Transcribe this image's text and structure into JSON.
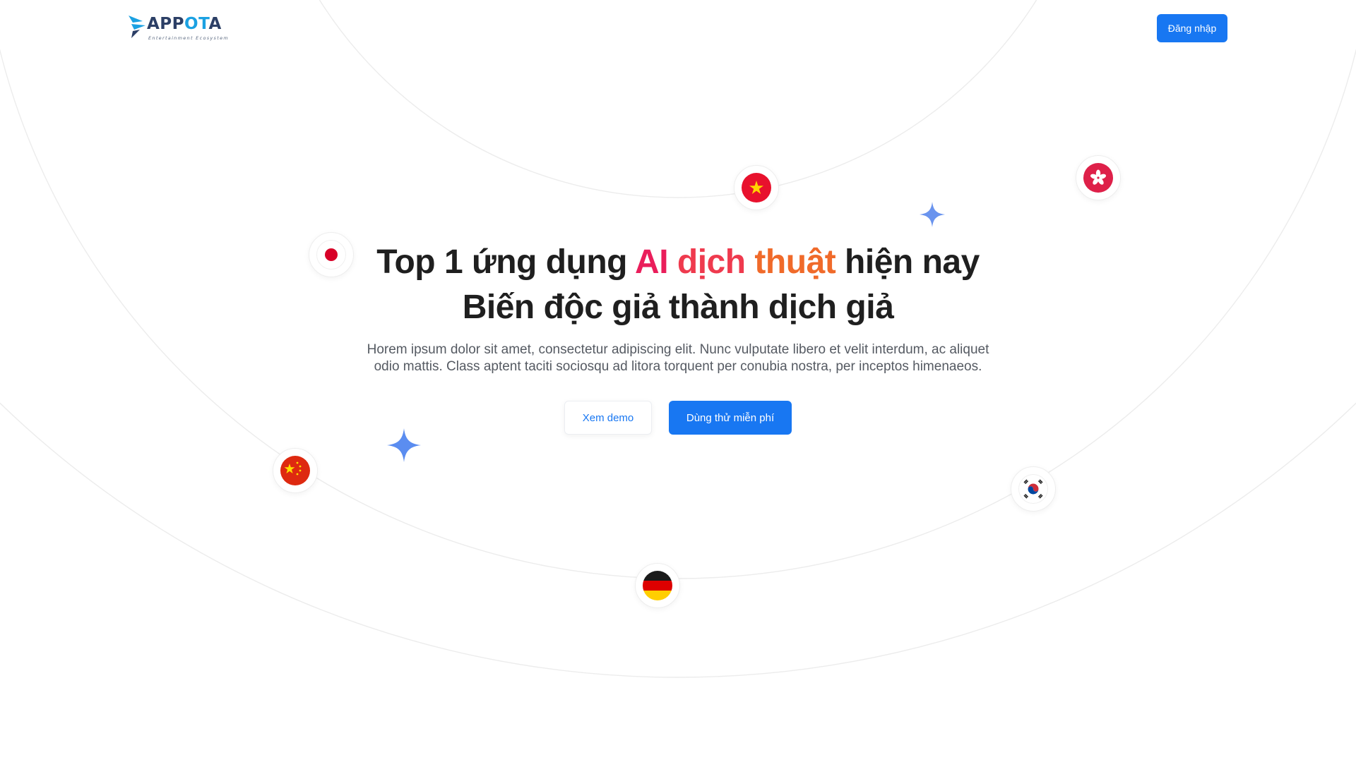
{
  "brand": {
    "logo_main": "APP",
    "logo_accent": "OT",
    "logo_end": "A",
    "tagline": "Entertainment Ecosystem",
    "accent_color": "#1ba1e2",
    "primary_color": "#1877f2"
  },
  "header": {
    "login_label": "Đăng nhập"
  },
  "hero": {
    "headline_part1": "Top 1 ứng dụng ",
    "headline_ai": "AI ",
    "headline_dich": "dịch ",
    "headline_thuat": "thuật",
    "headline_part2": " hiện nay",
    "headline_line2": "Biến độc giả thành dịch giả",
    "subtitle": "Horem ipsum dolor sit amet, consectetur adipiscing elit. Nunc vulputate libero et velit interdum, ac aliquet odio mattis. Class aptent taciti sociosqu ad litora torquent per conubia nostra, per inceptos himenaeos.",
    "demo_label": "Xem demo",
    "try_label": "Dùng thử miễn phí"
  },
  "flags": [
    {
      "country": "Vietnam",
      "icon": "vietnam-flag-icon"
    },
    {
      "country": "Hong Kong",
      "icon": "hong-kong-flag-icon"
    },
    {
      "country": "Japan",
      "icon": "japan-flag-icon"
    },
    {
      "country": "China",
      "icon": "china-flag-icon"
    },
    {
      "country": "South Korea",
      "icon": "south-korea-flag-icon"
    },
    {
      "country": "Germany",
      "icon": "germany-flag-icon"
    }
  ],
  "decor": {
    "sparkle_icon": "sparkle-icon",
    "sparkle_color": "#5b8df0",
    "highlight_colors": [
      "#ea1e5b",
      "#ef3a4e",
      "#f06a2a"
    ]
  }
}
